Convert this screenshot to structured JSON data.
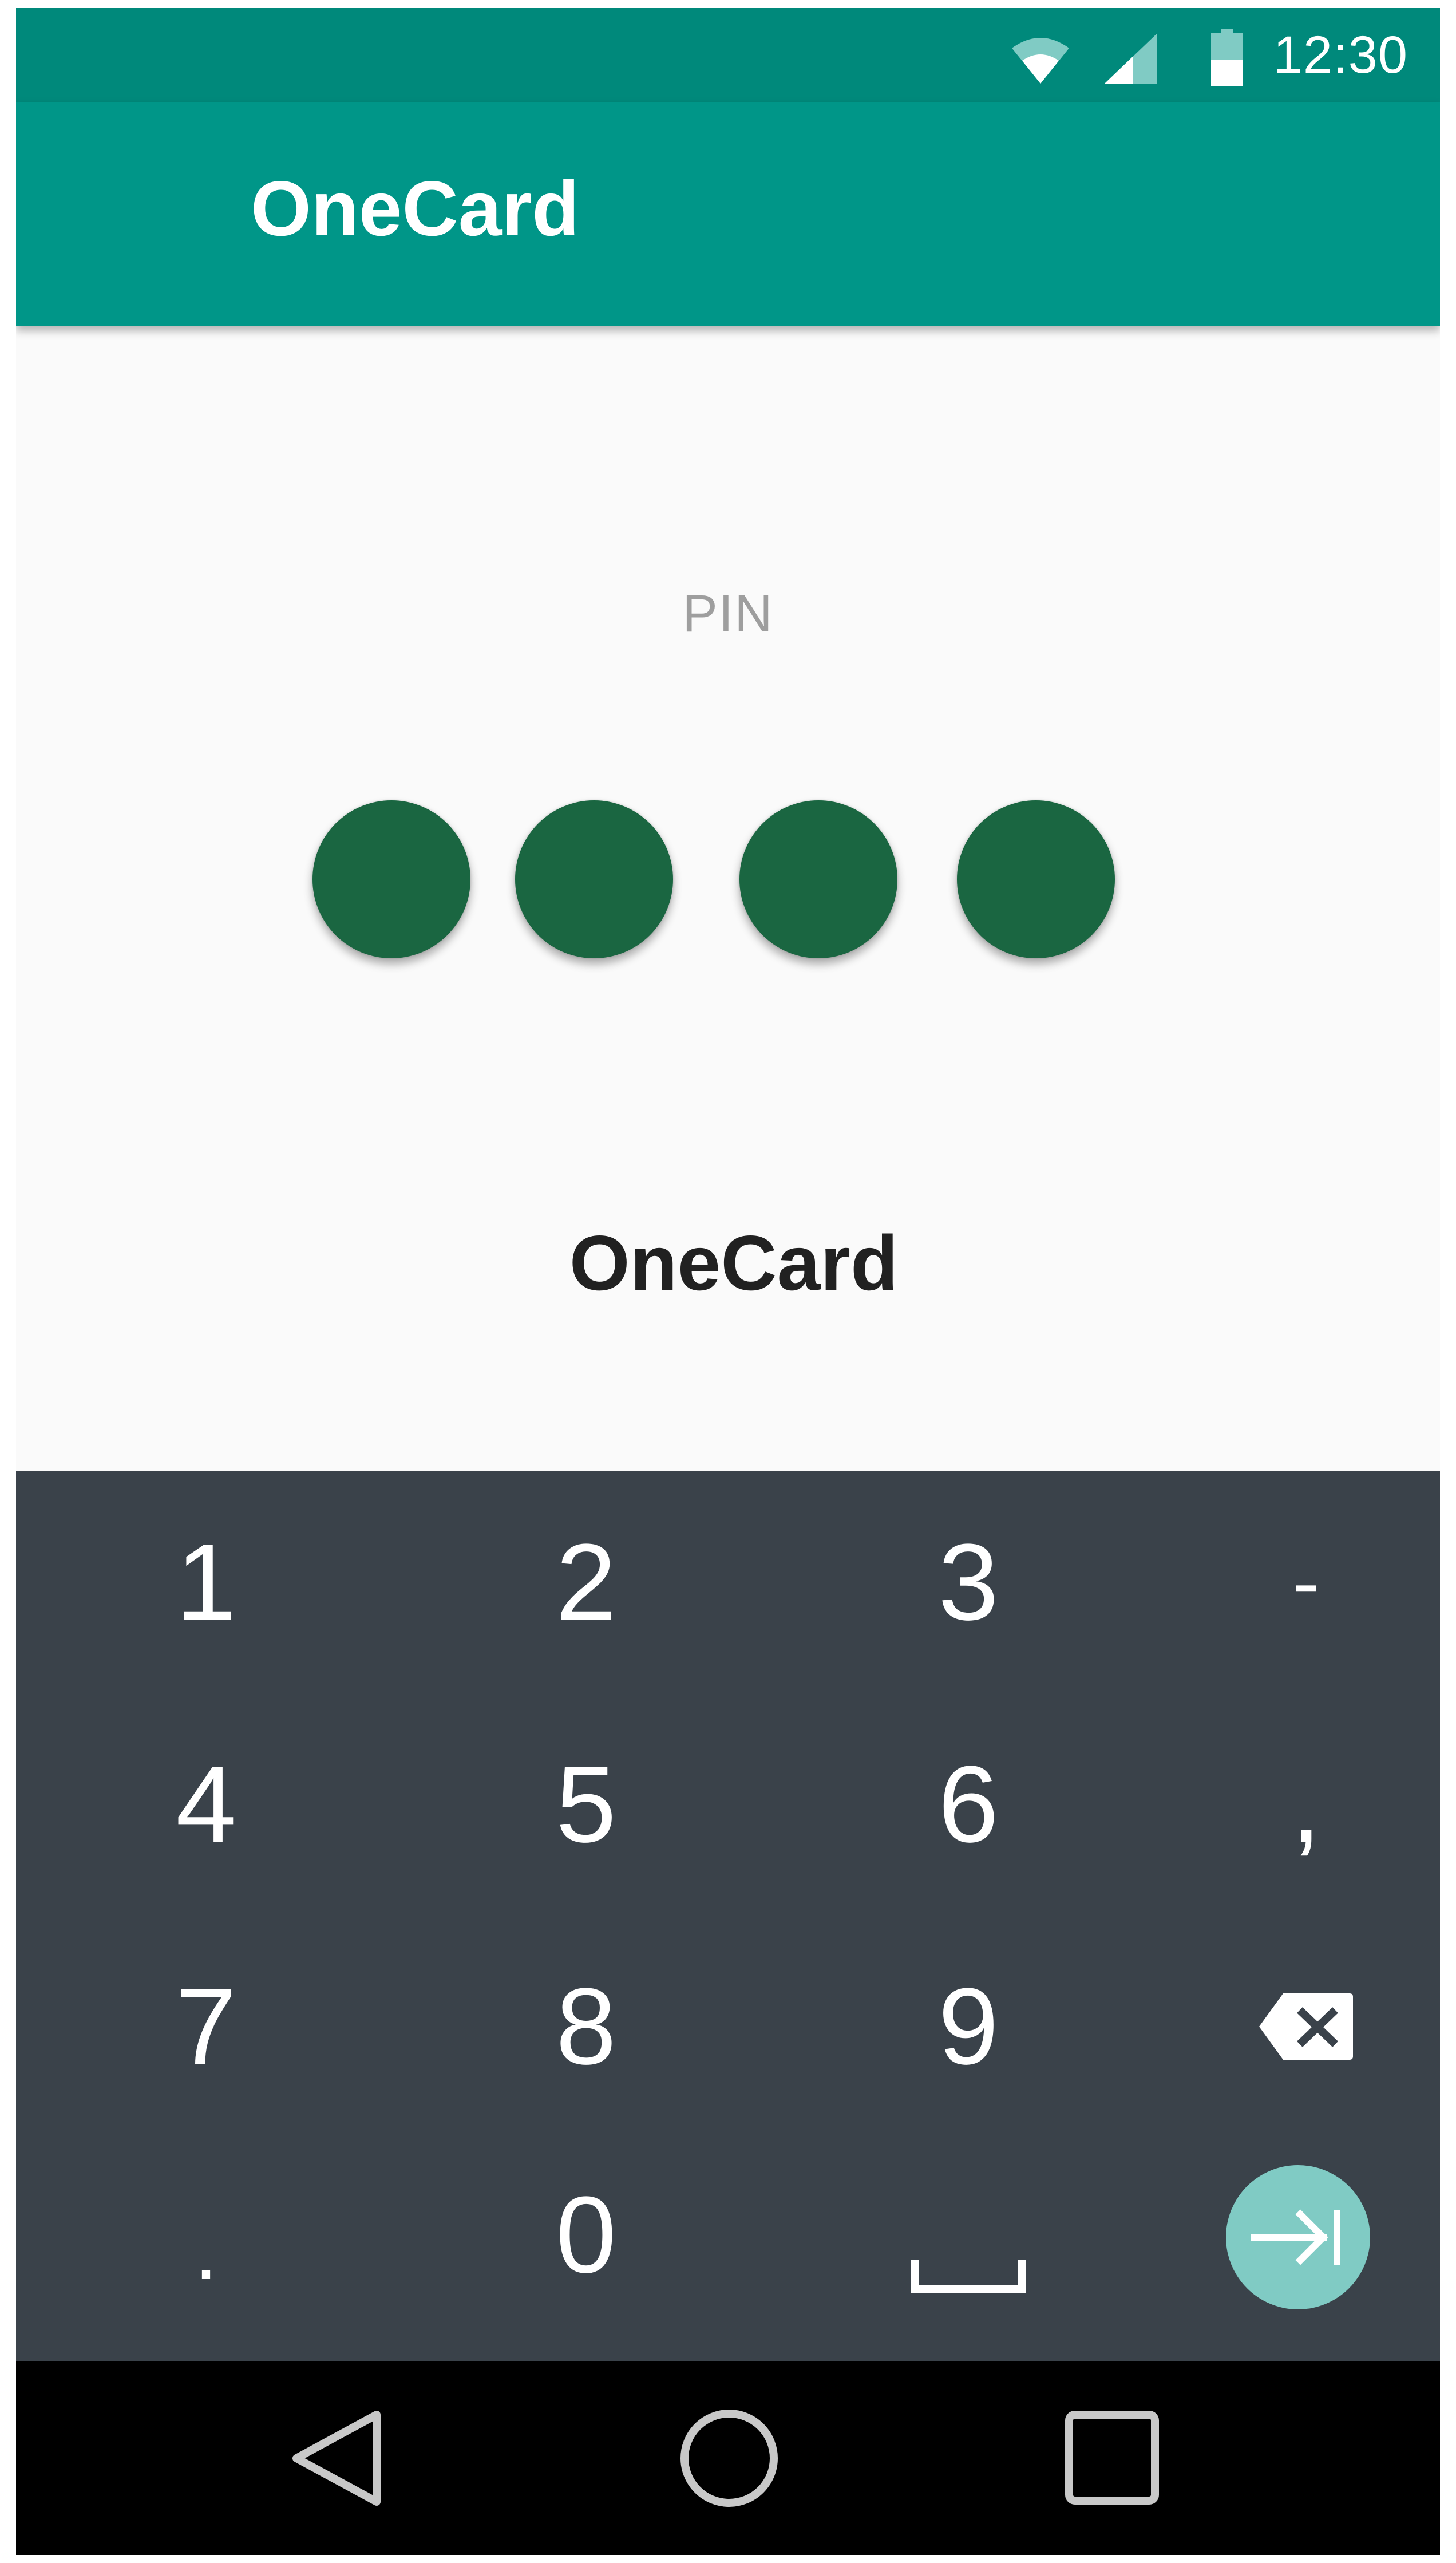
{
  "status_bar": {
    "time": "12:30",
    "icons": [
      "wifi-icon",
      "cell-signal-icon",
      "battery-icon"
    ],
    "color": "#00897b"
  },
  "app_bar": {
    "title": "OneCard",
    "color": "#009688"
  },
  "content": {
    "pin_label": "PIN",
    "pin_dots_filled": 4,
    "dot_color": "#1a6641",
    "footer_name": "OneCard"
  },
  "keyboard": {
    "background": "#3a424a",
    "rows": [
      [
        "1",
        "2",
        "3",
        "-"
      ],
      [
        "4",
        "5",
        "6",
        ","
      ],
      [
        "7",
        "8",
        "9",
        "backspace-icon"
      ],
      [
        ".",
        "0",
        "space-icon",
        "enter-icon"
      ]
    ],
    "enter_color": "#80cbc4"
  },
  "nav_bar": {
    "buttons": [
      "back-icon",
      "home-icon",
      "recents-icon"
    ]
  }
}
